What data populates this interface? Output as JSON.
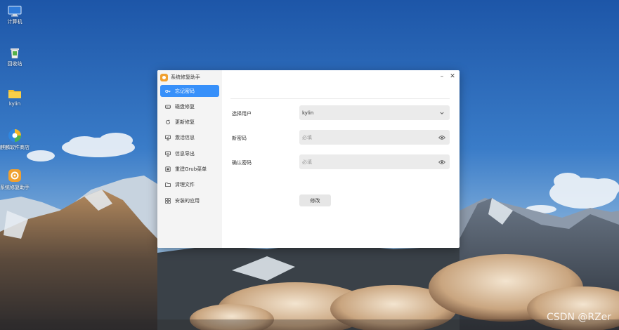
{
  "desktop": {
    "icons": [
      {
        "label": "计算机",
        "icon": "computer-icon"
      },
      {
        "label": "回收站",
        "icon": "trash-icon"
      },
      {
        "label": "kylin",
        "icon": "folder-icon"
      },
      {
        "label": "麒麟软件商店",
        "icon": "store-icon"
      },
      {
        "label": "系统修复助手",
        "icon": "repair-assistant-icon"
      }
    ]
  },
  "window": {
    "title": "系统修复助手",
    "minimize": "–",
    "close": "✕",
    "nav": [
      {
        "label": "忘记密码",
        "icon": "key-icon",
        "active": true
      },
      {
        "label": "磁盘修复",
        "icon": "disk-icon",
        "active": false
      },
      {
        "label": "更新修复",
        "icon": "refresh-icon",
        "active": false
      },
      {
        "label": "激活信息",
        "icon": "monitor-icon",
        "active": false
      },
      {
        "label": "信息导出",
        "icon": "export-icon",
        "active": false
      },
      {
        "label": "重建Grub菜单",
        "icon": "grub-icon",
        "active": false
      },
      {
        "label": "清理文件",
        "icon": "folder-icon",
        "active": false
      },
      {
        "label": "安装的应用",
        "icon": "apps-grid-icon",
        "active": false
      }
    ],
    "form": {
      "user_label": "选择用户",
      "user_value": "kylin",
      "new_password_label": "新密码",
      "new_password_placeholder": "必填",
      "confirm_password_label": "确认密码",
      "confirm_password_placeholder": "必填",
      "submit_label": "修改"
    }
  },
  "watermark": "CSDN @RZer",
  "colors": {
    "accent": "#3790fa",
    "sidebar_bg": "#f4f4f4",
    "field_bg": "#ebebeb"
  }
}
